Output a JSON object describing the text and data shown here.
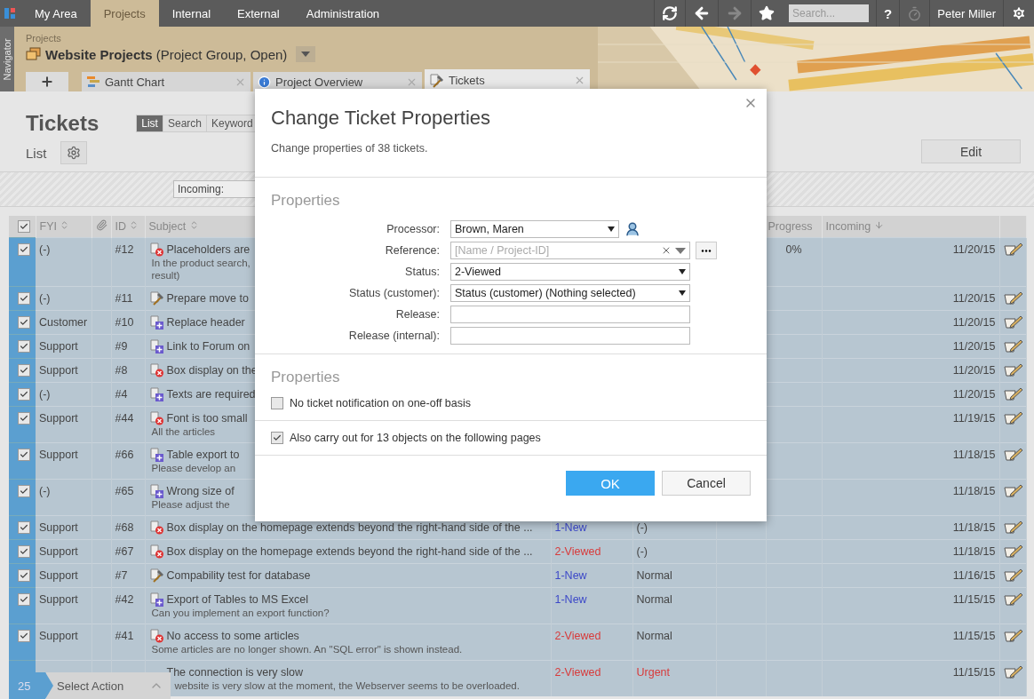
{
  "top_nav": {
    "tabs": [
      {
        "label": "My Area",
        "selected": false
      },
      {
        "label": "Projects",
        "selected": true
      },
      {
        "label": "Internal",
        "selected": false
      },
      {
        "label": "External",
        "selected": false
      },
      {
        "label": "Administration",
        "selected": false
      }
    ],
    "search": {
      "placeholder": "Search..."
    },
    "help": "?",
    "user": "Peter Miller"
  },
  "navigator": {
    "label": "Navigator"
  },
  "project": {
    "breadcrumb": "Projects",
    "title": "Website Projects",
    "subtitle": "(Project Group, Open)"
  },
  "project_tabs": [
    {
      "label": "Gantt Chart",
      "kind": "gantt",
      "selected": false
    },
    {
      "label": "Project Overview",
      "kind": "info",
      "selected": false
    },
    {
      "label": "Tickets",
      "kind": "tickets",
      "selected": true
    }
  ],
  "page": {
    "title": "Tickets",
    "views": [
      {
        "label": "List",
        "selected": true
      },
      {
        "label": "Search",
        "selected": false
      },
      {
        "label": "Keyword",
        "selected": false
      }
    ],
    "subtitle": "List",
    "edit_button": "Edit",
    "filter": "Incoming:"
  },
  "table": {
    "all_checked": true,
    "columns": {
      "fyi": "FYI",
      "id": "ID",
      "subject": "Subject",
      "progress": "Progress",
      "incoming": "Incoming"
    },
    "rows": [
      {
        "checked": true,
        "fyi": "(-)",
        "id": "#12",
        "kind": "bug",
        "subject": "Placeholders are",
        "description": [
          "In the product search,",
          "result)"
        ],
        "progress": "0%",
        "incoming": "11/20/15"
      },
      {
        "checked": true,
        "fyi": "(-)",
        "id": "#11",
        "kind": "task",
        "subject": "Prepare move to",
        "incoming": "11/20/15"
      },
      {
        "checked": true,
        "fyi": "Customer",
        "id": "#10",
        "kind": "feature",
        "subject": "Replace header",
        "incoming": "11/20/15"
      },
      {
        "checked": true,
        "fyi": "Support",
        "id": "#9",
        "kind": "feature",
        "subject": "Link to Forum on",
        "incoming": "11/20/15"
      },
      {
        "checked": true,
        "fyi": "Support",
        "id": "#8",
        "kind": "bug",
        "subject": "Box display on the",
        "incoming": "11/20/15"
      },
      {
        "checked": true,
        "fyi": "(-)",
        "id": "#4",
        "kind": "feature",
        "subject": "Texts are required",
        "incoming": "11/20/15"
      },
      {
        "checked": true,
        "fyi": "Support",
        "id": "#44",
        "kind": "bug",
        "subject": "Font is too small",
        "description": [
          "All the articles"
        ],
        "incoming": "11/19/15"
      },
      {
        "checked": true,
        "fyi": "Support",
        "id": "#66",
        "kind": "feature",
        "subject": "Table export to",
        "description": [
          "Please develop an"
        ],
        "incoming": "11/18/15"
      },
      {
        "checked": true,
        "fyi": "(-)",
        "id": "#65",
        "kind": "feature",
        "subject": "Wrong size of",
        "description": [
          "Please adjust the"
        ],
        "incoming": "11/18/15"
      },
      {
        "checked": true,
        "fyi": "Support",
        "id": "#68",
        "kind": "bug",
        "subject": "Box display on the homepage extends beyond the right-hand side of the ...",
        "status": {
          "text": "1-New",
          "color": "#3c48c8"
        },
        "priority": {
          "text": "(-)",
          "color": "#444444"
        },
        "incoming": "11/18/15"
      },
      {
        "checked": true,
        "fyi": "Support",
        "id": "#67",
        "kind": "bug",
        "subject": "Box display on the homepage extends beyond the right-hand side of the ...",
        "status": {
          "text": "2-Viewed",
          "color": "#d83a3a"
        },
        "priority": {
          "text": "(-)",
          "color": "#444444"
        },
        "incoming": "11/18/15"
      },
      {
        "checked": true,
        "fyi": "Support",
        "id": "#7",
        "kind": "task",
        "subject": "Compability test for database",
        "status": {
          "text": "1-New",
          "color": "#3c48c8"
        },
        "priority": {
          "text": "Normal",
          "color": "#444444"
        },
        "incoming": "11/16/15"
      },
      {
        "checked": true,
        "fyi": "Support",
        "id": "#42",
        "kind": "feature",
        "subject": "Export of Tables to MS Excel",
        "description": [
          "Can you implement an export function?"
        ],
        "status": {
          "text": "1-New",
          "color": "#3c48c8"
        },
        "priority": {
          "text": "Normal",
          "color": "#444444"
        },
        "incoming": "11/15/15"
      },
      {
        "checked": true,
        "fyi": "Support",
        "id": "#41",
        "kind": "bug",
        "subject": "No access to some articles",
        "description": [
          "Some articles are no longer shown. An \"SQL error\" is shown instead."
        ],
        "status": {
          "text": "2-Viewed",
          "color": "#d83a3a"
        },
        "priority": {
          "text": "Normal",
          "color": "#444444"
        },
        "incoming": "11/15/15"
      },
      {
        "kind": "hidden",
        "subject": "The connection is very slow",
        "description": [
          "website is very slow at the moment, the Webserver seems to be overloaded."
        ],
        "status": {
          "text": "2-Viewed",
          "color": "#d83a3a"
        },
        "priority": {
          "text": "Urgent",
          "color": "#d83a3a"
        },
        "incoming": "11/15/15"
      }
    ]
  },
  "action_bar": {
    "count": "25",
    "label": "Select Action"
  },
  "dialog": {
    "title": "Change Ticket Properties",
    "intro": "Change properties of 38 tickets.",
    "section_1": "Properties",
    "fields": [
      {
        "label": "Processor:",
        "kind": "person",
        "value": "Brown, Maren"
      },
      {
        "label": "Reference:",
        "kind": "reference",
        "placeholder": "[Name / Project-ID]"
      },
      {
        "label": "Status:",
        "kind": "select",
        "value": "2-Viewed"
      },
      {
        "label": "Status (customer):",
        "kind": "select",
        "value": "Status (customer) (Nothing selected)"
      },
      {
        "label": "Release:",
        "kind": "text"
      },
      {
        "label": "Release (internal):",
        "kind": "text"
      }
    ],
    "section_2": "Properties",
    "options": [
      {
        "label": "No ticket notification on one-off basis",
        "checked": false
      },
      {
        "label": "Also carry out for 13 objects on the following pages",
        "checked": true
      }
    ],
    "ok": "OK",
    "cancel": "Cancel"
  }
}
